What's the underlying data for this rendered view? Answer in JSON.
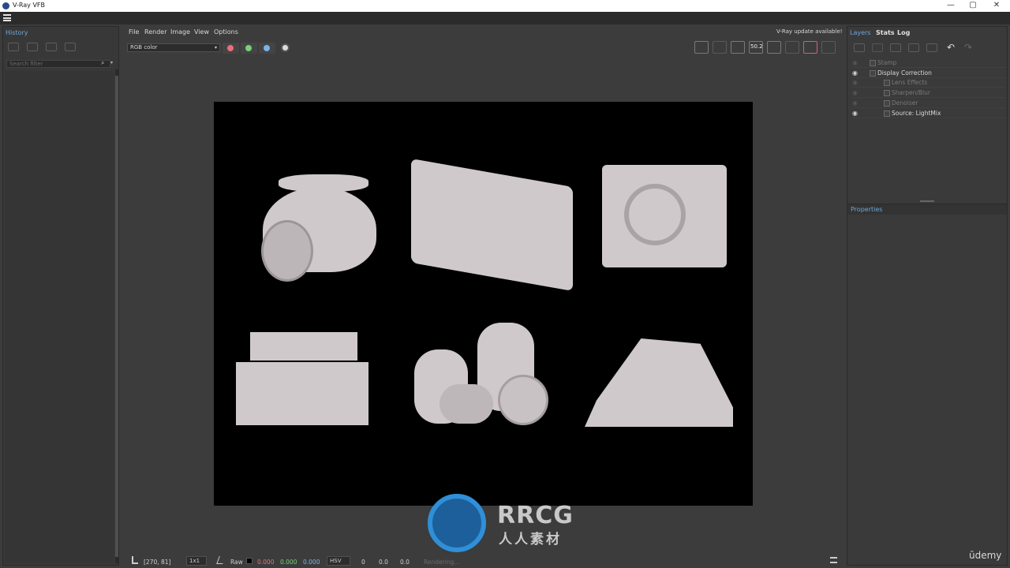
{
  "window": {
    "title": "V-Ray VFB",
    "buttons": {
      "minimize": "—",
      "maximize": "▢",
      "close": "✕"
    }
  },
  "history": {
    "tab_label": "History",
    "search_placeholder": "Search filter"
  },
  "menu": {
    "items": [
      "File",
      "Render",
      "Image",
      "View",
      "Options"
    ],
    "update_notice": "V-Ray update available!"
  },
  "toolbar": {
    "channel_select": "RGB color",
    "channel_colors": {
      "red": "#e8707a",
      "green": "#7ad07a",
      "blue": "#7ab4e8"
    },
    "zoom_label": "50.2"
  },
  "right_panel": {
    "tabs": [
      "Layers",
      "Stats",
      "Log"
    ],
    "layers": [
      {
        "name": "Stamp",
        "visible": false,
        "enabled": false
      },
      {
        "name": "Display Correction",
        "visible": true,
        "enabled": true
      },
      {
        "name": "Lens Effects",
        "visible": false,
        "enabled": false
      },
      {
        "name": "Sharpen/Blur",
        "visible": false,
        "enabled": false
      },
      {
        "name": "Denoiser",
        "visible": false,
        "enabled": false
      },
      {
        "name": "Source: LightMix",
        "visible": true,
        "enabled": true
      }
    ],
    "properties_label": "Properties"
  },
  "status_bar": {
    "coords": "[270, 81]",
    "sample_mode": "1x1",
    "raw_label": "Raw",
    "r_value": "0.000",
    "g_value": "0.000",
    "b_value": "0.000",
    "color_space": "HSV",
    "h_value": "0",
    "s_value": "0.0",
    "v_value": "0.0",
    "render_status": "Rendering..."
  },
  "watermark": {
    "brand": "RRCG",
    "subtitle": "人人素材",
    "udemy": "ūdemy"
  }
}
